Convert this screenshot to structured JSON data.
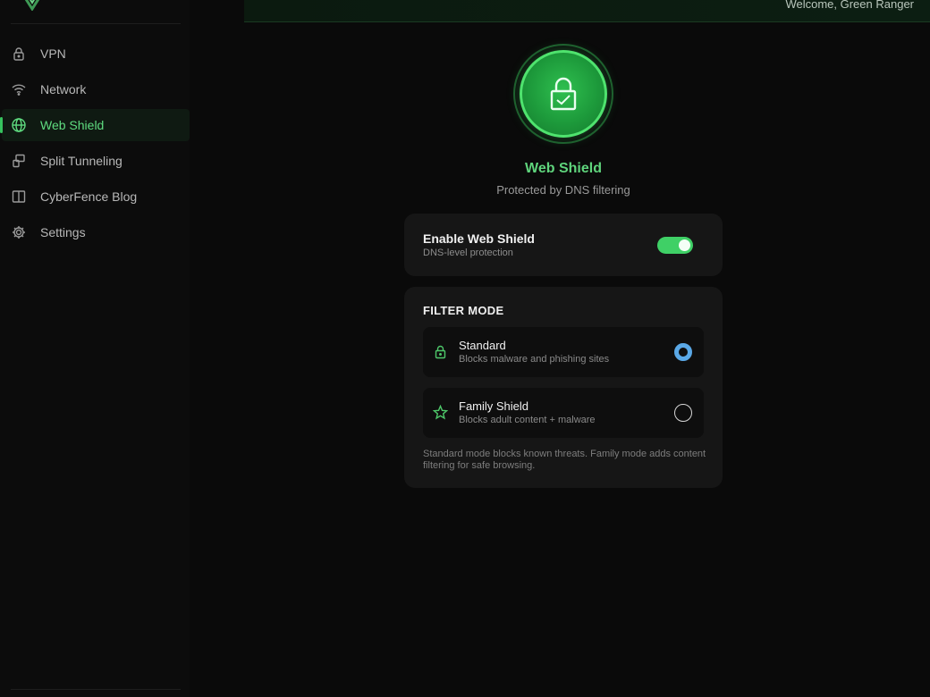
{
  "header": {
    "welcome": "Welcome, Green Ranger"
  },
  "sidebar": {
    "items": [
      {
        "label": "VPN",
        "icon": "lock-icon",
        "active": false
      },
      {
        "label": "Network",
        "icon": "wifi-icon",
        "active": false
      },
      {
        "label": "Web Shield",
        "icon": "globe-icon",
        "active": true
      },
      {
        "label": "Split Tunneling",
        "icon": "split-icon",
        "active": false
      },
      {
        "label": "CyberFence Blog",
        "icon": "book-icon",
        "active": false
      },
      {
        "label": "Settings",
        "icon": "gear-icon",
        "active": false
      }
    ]
  },
  "main": {
    "title": "Web Shield",
    "subtitle": "Protected by DNS filtering",
    "toggle": {
      "title": "Enable Web Shield",
      "subtitle": "DNS-level protection",
      "enabled": true
    },
    "filter": {
      "heading": "FILTER MODE",
      "options": [
        {
          "name": "Standard",
          "desc": "Blocks malware and phishing sites",
          "icon": "lock-icon",
          "selected": true
        },
        {
          "name": "Family Shield",
          "desc": "Blocks adult content + malware",
          "icon": "star-icon",
          "selected": false
        }
      ],
      "note": "Standard mode blocks known threats. Family mode adds content filtering for safe browsing."
    }
  },
  "colors": {
    "accent": "#3fd066",
    "accent_text": "#5fd47c",
    "radio_selected": "#5aa8e6",
    "background": "#0a0a0a",
    "card": "#161616"
  }
}
